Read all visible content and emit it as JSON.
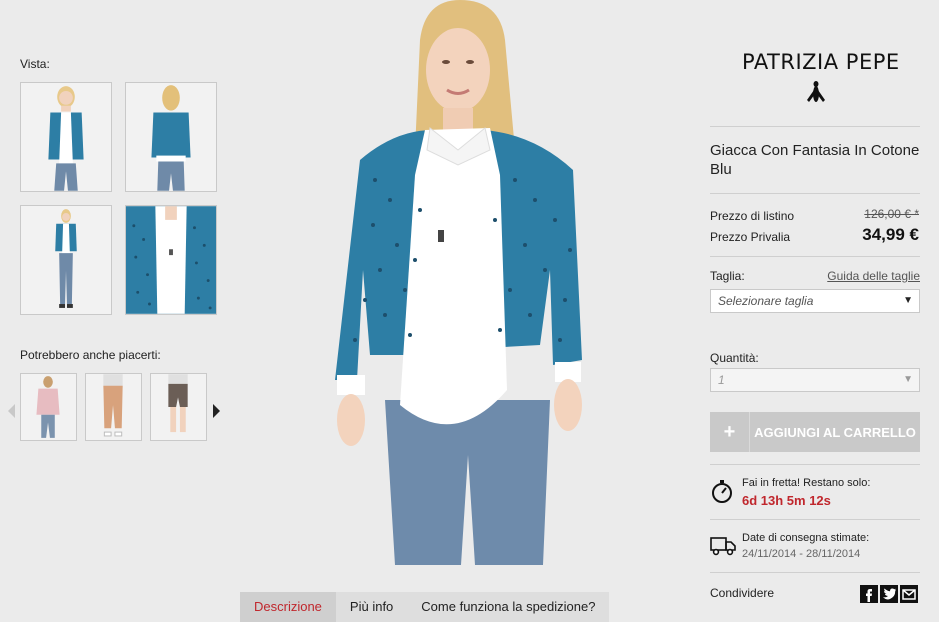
{
  "gallery": {
    "label": "Vista:",
    "thumbnails": [
      "front-view",
      "back-view",
      "full-body-view",
      "detail-view"
    ]
  },
  "recommendations": {
    "label": "Potrebbero anche piacerti:",
    "items": [
      "pink-cardigan",
      "tan-trousers",
      "brown-shorts"
    ]
  },
  "tabs": [
    {
      "label": "Descrizione",
      "active": true
    },
    {
      "label": "Più info",
      "active": false
    },
    {
      "label": "Come funziona la spedizione?",
      "active": false
    }
  ],
  "brand": {
    "name": "PATRIZIA PEPE",
    "logo_icon": "fly-icon"
  },
  "product": {
    "title": "Giacca Con Fantasia In Cotone Blu",
    "list_price_label": "Prezzo di listino",
    "list_price": "126,00 € *",
    "sale_price_label": "Prezzo Privalia",
    "sale_price": "34,99 €"
  },
  "size": {
    "label": "Taglia:",
    "guide_link": "Guida delle taglie",
    "placeholder": "Selezionare taglia"
  },
  "quantity": {
    "label": "Quantità:",
    "value": "1"
  },
  "cart": {
    "plus": "+",
    "label": "AGGIUNGI AL CARRELLO"
  },
  "urgency": {
    "text": "Fai in fretta! Restano solo:",
    "countdown": "6d 13h 5m 12s",
    "icon": "stopwatch-icon"
  },
  "delivery": {
    "label": "Date di consegna stimate:",
    "dates": "24/11/2014 - 28/11/2014",
    "icon": "truck-icon"
  },
  "share": {
    "label": "Condividere",
    "networks": [
      "facebook",
      "twitter",
      "email"
    ]
  },
  "colors": {
    "accent": "#c0272d",
    "jacket": "#2d7ea5",
    "button_disabled": "#c9c9c9",
    "background": "#ebebeb"
  }
}
